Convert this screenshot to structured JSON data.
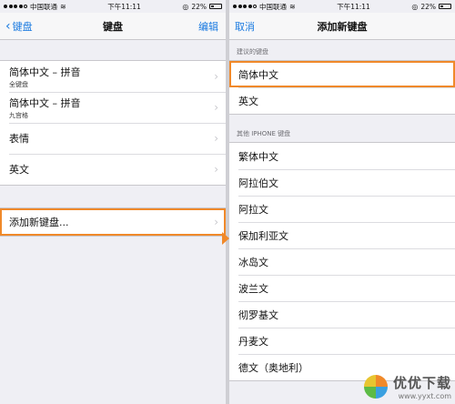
{
  "left": {
    "status": {
      "carrier": "中国联通",
      "time": "下午11:11",
      "battery": "22%"
    },
    "nav": {
      "back": "键盘",
      "title": "键盘",
      "edit": "编辑"
    },
    "rows": [
      {
        "label": "简体中文 – 拼音",
        "sub": "全键盘"
      },
      {
        "label": "简体中文 – 拼音",
        "sub": "九宫格"
      },
      {
        "label": "表情",
        "sub": ""
      },
      {
        "label": "英文",
        "sub": ""
      }
    ],
    "add_row": "添加新键盘..."
  },
  "right": {
    "status": {
      "carrier": "中国联通",
      "time": "下午11:11",
      "battery": "22%"
    },
    "nav": {
      "cancel": "取消",
      "title": "添加新键盘"
    },
    "suggested_header": "建议的键盘",
    "suggested": [
      "简体中文",
      "英文"
    ],
    "other_header": "其他 IPHONE 键盘",
    "other": [
      "繁体中文",
      "阿拉伯文",
      "阿拉文",
      "保加利亚文",
      "冰岛文",
      "波兰文",
      "彻罗基文",
      "丹麦文",
      "德文（奥地利）"
    ]
  },
  "watermark": {
    "main": "优优下载",
    "url": "www.yyxt.com"
  },
  "colors": {
    "accent": "#f0892a",
    "ios_blue": "#1a7ae0"
  }
}
